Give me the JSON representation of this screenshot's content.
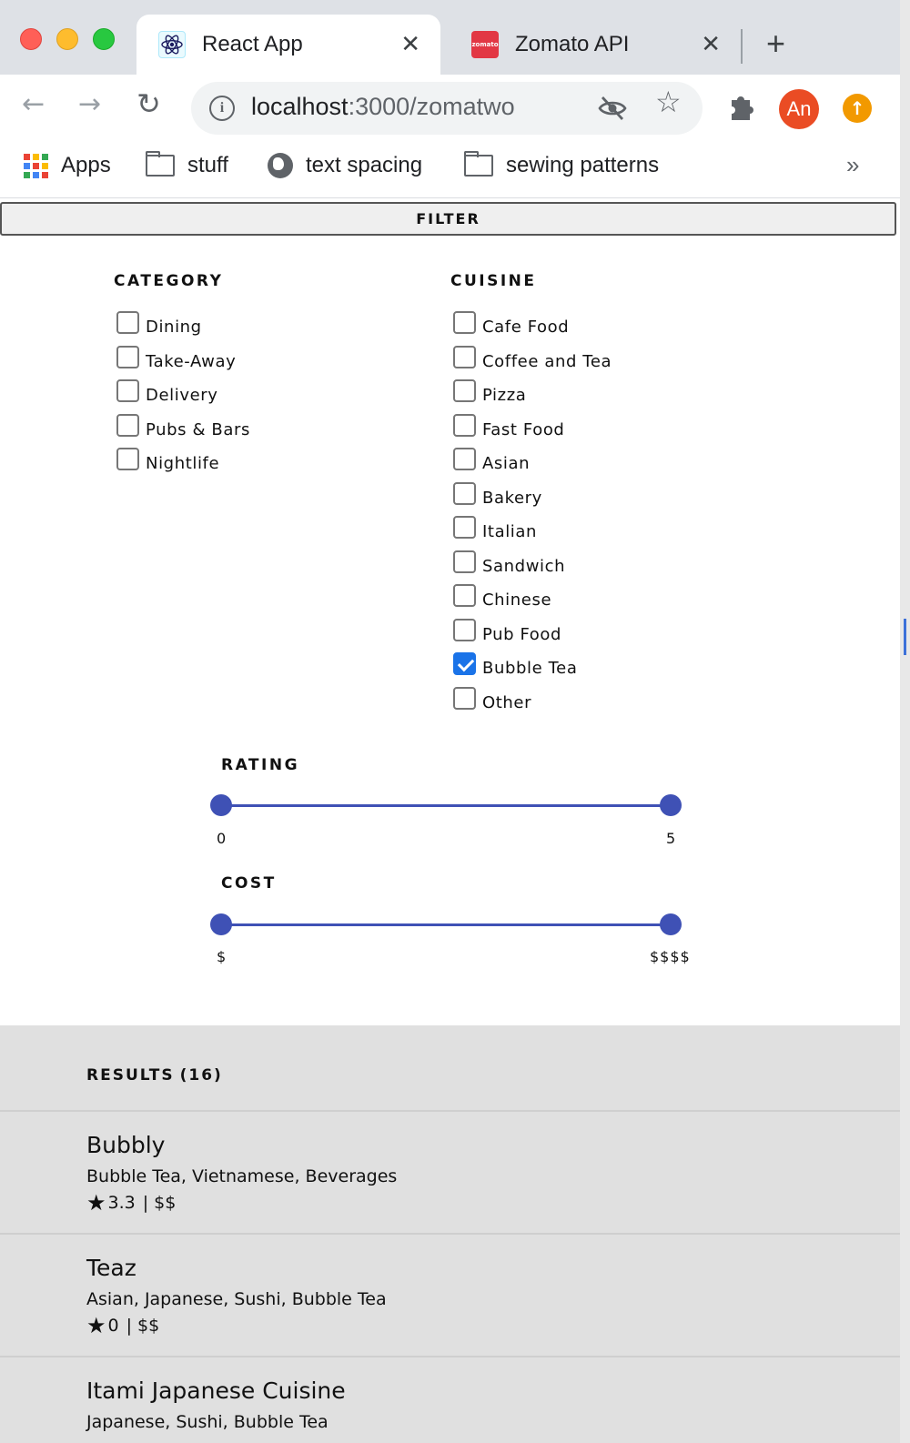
{
  "browser": {
    "tabs": [
      {
        "title": "React App",
        "favicon": "react-icon",
        "active": true
      },
      {
        "title": "Zomato API",
        "favicon": "zomato-icon",
        "favicon_text": "zomato",
        "active": false
      }
    ],
    "url": {
      "host": "localhost",
      "rest": ":3000/zomatwo"
    },
    "avatar_initials": "An",
    "bookmarks": [
      {
        "label": "Apps",
        "icon": "apps-grid-icon"
      },
      {
        "label": "stuff",
        "icon": "folder-icon"
      },
      {
        "label": "text spacing",
        "icon": "globe-icon"
      },
      {
        "label": "sewing patterns",
        "icon": "folder-icon"
      }
    ],
    "bookmarks_more": "»",
    "colors": {
      "tabstrip": "#dee1e6",
      "avatar": "#ea4c24",
      "update": "#f29900"
    }
  },
  "filter": {
    "button_label": "FILTER",
    "category": {
      "title": "CATEGORY",
      "items": [
        {
          "label": "Dining",
          "checked": false
        },
        {
          "label": "Take-Away",
          "checked": false
        },
        {
          "label": "Delivery",
          "checked": false
        },
        {
          "label": "Pubs & Bars",
          "checked": false
        },
        {
          "label": "Nightlife",
          "checked": false
        }
      ]
    },
    "cuisine": {
      "title": "CUISINE",
      "items": [
        {
          "label": "Cafe Food",
          "checked": false
        },
        {
          "label": "Coffee and Tea",
          "checked": false
        },
        {
          "label": "Pizza",
          "checked": false
        },
        {
          "label": "Fast Food",
          "checked": false
        },
        {
          "label": "Asian",
          "checked": false
        },
        {
          "label": "Bakery",
          "checked": false
        },
        {
          "label": "Italian",
          "checked": false
        },
        {
          "label": "Sandwich",
          "checked": false
        },
        {
          "label": "Chinese",
          "checked": false
        },
        {
          "label": "Pub Food",
          "checked": false
        },
        {
          "label": "Bubble Tea",
          "checked": true
        },
        {
          "label": "Other",
          "checked": false
        }
      ]
    },
    "rating": {
      "title": "RATING",
      "min_label": "0",
      "max_label": "5",
      "min": 0,
      "max": 5,
      "low": 0,
      "high": 5
    },
    "cost": {
      "title": "COST",
      "min_label": "$",
      "max_label": "$$$$",
      "min": 1,
      "max": 4,
      "low": 1,
      "high": 4
    },
    "accent_color": "#3f51b5"
  },
  "results": {
    "title": "RESULTS",
    "count": "(16)",
    "items": [
      {
        "name": "Bubbly",
        "cuisines": "Bubble Tea, Vietnamese, Beverages",
        "rating": "3.3",
        "cost": "$$"
      },
      {
        "name": "Teaz",
        "cuisines": "Asian, Japanese, Sushi, Bubble Tea",
        "rating": "0",
        "cost": "$$"
      },
      {
        "name": "Itami Japanese Cuisine",
        "cuisines": "Japanese, Sushi, Bubble Tea",
        "rating": "",
        "cost": ""
      }
    ]
  }
}
